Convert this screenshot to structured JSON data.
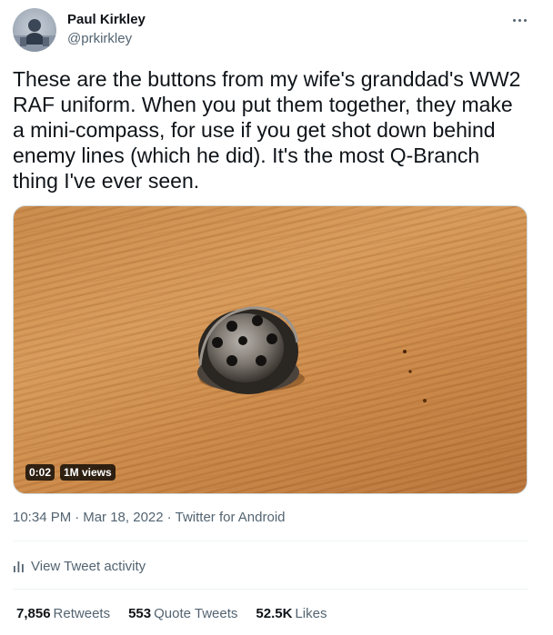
{
  "author": {
    "name": "Paul Kirkley",
    "handle": "@prkirkley"
  },
  "tweet": {
    "text": "These are the buttons from my wife's granddad's WW2\nRAF uniform. When you put them together, they make\na mini-compass, for use if you get shot down behind\nenemy lines (which he did). It's the most Q-Branch\nthing I've ever seen."
  },
  "media": {
    "duration": "0:02",
    "views": "1M views"
  },
  "meta": {
    "time": "10:34 PM",
    "date": "Mar 18, 2022",
    "source": "Twitter for Android",
    "separator": "·"
  },
  "activity": {
    "label": "View Tweet activity",
    "icon": "bar-chart-icon"
  },
  "stats": {
    "retweets_count": "7,856",
    "retweets_label": "Retweets",
    "quotes_count": "553",
    "quotes_label": "Quote Tweets",
    "likes_count": "52.5K",
    "likes_label": "Likes"
  },
  "colors": {
    "text_primary": "#0f1419",
    "text_secondary": "#536471",
    "divider": "#eff3f4"
  }
}
